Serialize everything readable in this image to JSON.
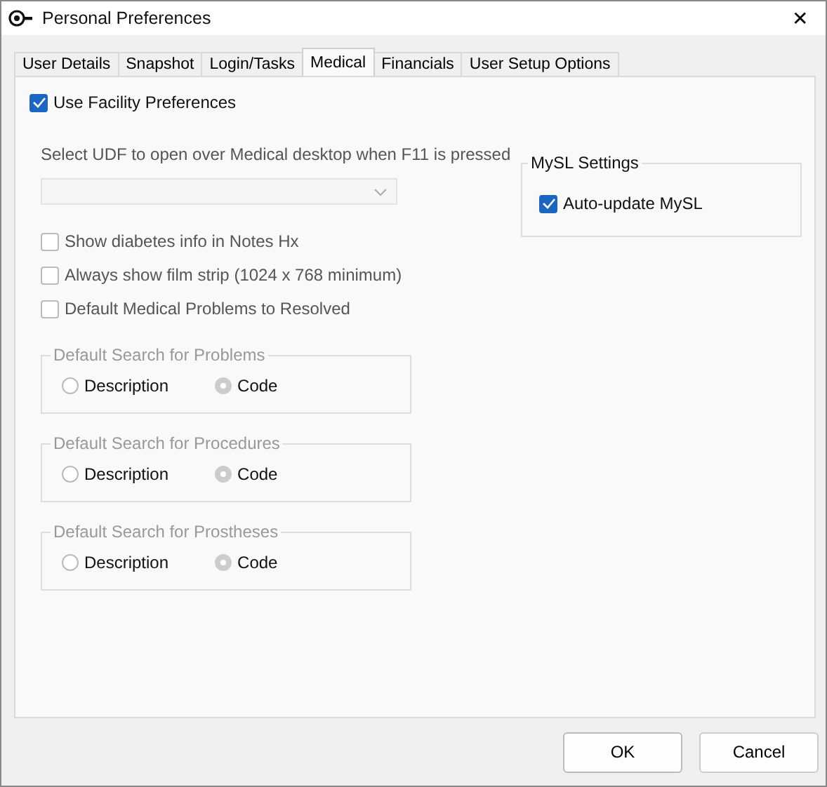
{
  "window": {
    "title": "Personal Preferences",
    "close": "✕"
  },
  "tabs": [
    {
      "label": "User Details",
      "selected": false
    },
    {
      "label": "Snapshot",
      "selected": false
    },
    {
      "label": "Login/Tasks",
      "selected": false
    },
    {
      "label": "Medical",
      "selected": true
    },
    {
      "label": "Financials",
      "selected": false
    },
    {
      "label": "User Setup Options",
      "selected": false
    }
  ],
  "use_facility": {
    "label": "Use Facility Preferences",
    "checked": true
  },
  "udf": {
    "label": "Select UDF to open over Medical desktop when F11 is pressed",
    "disabled": true
  },
  "options": [
    {
      "label": "Show diabetes info in Notes Hx",
      "checked": false,
      "disabled": true
    },
    {
      "label": "Always show film strip (1024 x 768 minimum)",
      "checked": false,
      "disabled": true
    },
    {
      "label": "Default Medical Problems to Resolved",
      "checked": false,
      "disabled": true
    }
  ],
  "search_groups": [
    {
      "title": "Default Search for Problems",
      "disabled": true,
      "choices": [
        {
          "label": "Description",
          "selected": false
        },
        {
          "label": "Code",
          "selected": true
        }
      ]
    },
    {
      "title": "Default Search for Procedures",
      "disabled": true,
      "choices": [
        {
          "label": "Description",
          "selected": false
        },
        {
          "label": "Code",
          "selected": true
        }
      ]
    },
    {
      "title": "Default Search for Prostheses",
      "disabled": true,
      "choices": [
        {
          "label": "Description",
          "selected": false
        },
        {
          "label": "Code",
          "selected": true
        }
      ]
    }
  ],
  "mysl": {
    "title": "MySL Settings",
    "option": {
      "label": "Auto-update MySL",
      "checked": true
    }
  },
  "buttons": [
    "OK",
    "Cancel"
  ]
}
